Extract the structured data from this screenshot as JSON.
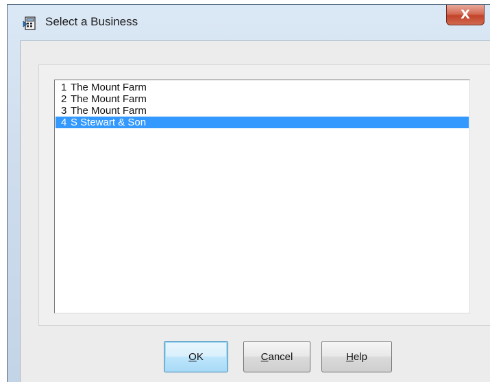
{
  "window": {
    "title": "Select a Business",
    "close_glyph": "X"
  },
  "businesses": [
    {
      "num": "1",
      "name": "The Mount Farm",
      "selected": false
    },
    {
      "num": "2",
      "name": "The Mount Farm",
      "selected": false
    },
    {
      "num": "3",
      "name": "The Mount Farm",
      "selected": false
    },
    {
      "num": "4",
      "name": "S Stewart & Son",
      "selected": true
    }
  ],
  "buttons": {
    "ok": {
      "accel": "O",
      "rest": "K"
    },
    "cancel": {
      "accel": "C",
      "rest": "ancel"
    },
    "help": {
      "accel": "H",
      "rest": "elp"
    }
  },
  "colors": {
    "selection": "#3399ff",
    "close_button": "#c2432b"
  },
  "icons": {
    "app": "calculator-icon",
    "close": "close-icon"
  }
}
